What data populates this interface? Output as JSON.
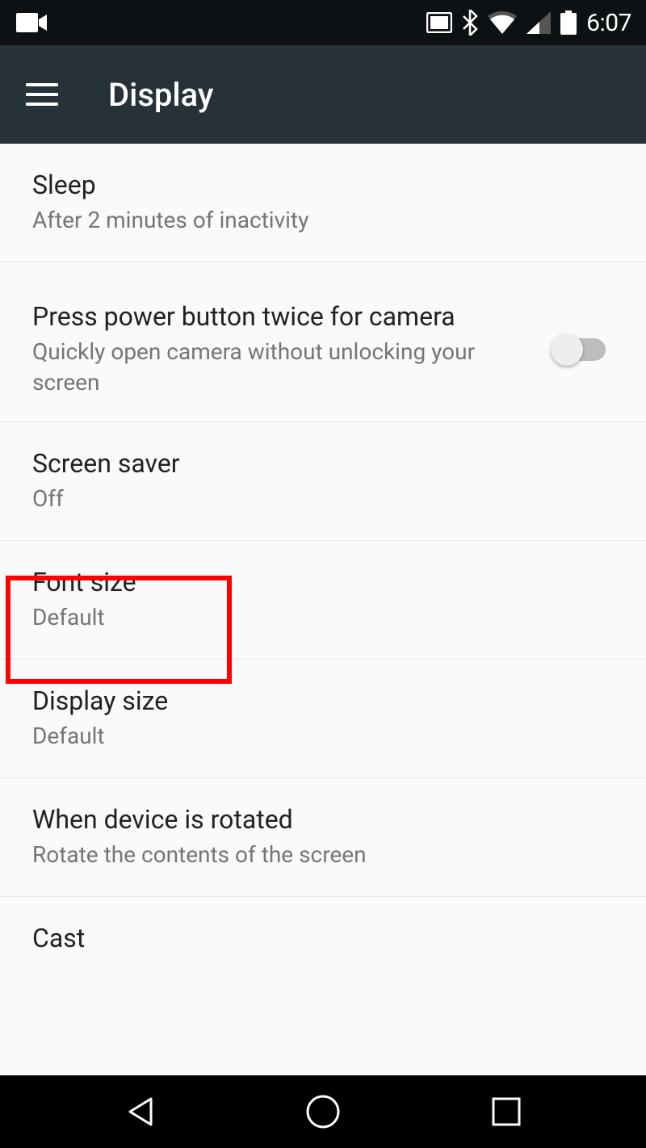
{
  "status_bar": {
    "time": "6:07"
  },
  "app_bar": {
    "title": "Display"
  },
  "settings": {
    "sleep": {
      "title": "Sleep",
      "subtitle": "After 2 minutes of inactivity"
    },
    "power_button_camera": {
      "title": "Press power button twice for camera",
      "subtitle": "Quickly open camera without unlocking your screen",
      "enabled": false
    },
    "screen_saver": {
      "title": "Screen saver",
      "subtitle": "Off"
    },
    "font_size": {
      "title": "Font size",
      "subtitle": "Default"
    },
    "display_size": {
      "title": "Display size",
      "subtitle": "Default"
    },
    "rotation": {
      "title": "When device is rotated",
      "subtitle": "Rotate the contents of the screen"
    },
    "cast": {
      "title": "Cast"
    }
  }
}
